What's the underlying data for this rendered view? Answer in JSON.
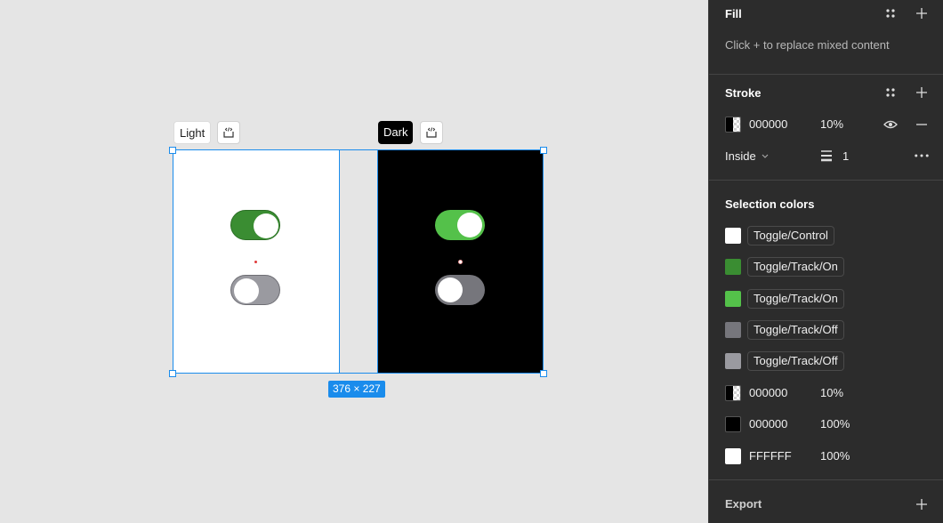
{
  "canvas": {
    "frames": [
      {
        "name": "Light"
      },
      {
        "name": "Dark"
      }
    ],
    "selection_size": "376 × 227"
  },
  "panel": {
    "fill": {
      "title": "Fill",
      "hint": "Click + to replace mixed content"
    },
    "stroke": {
      "title": "Stroke",
      "color": "000000",
      "opacity": "10%",
      "position": "Inside",
      "weight": "1"
    },
    "selection_colors": {
      "title": "Selection colors",
      "styles": [
        {
          "label": "Toggle/Control",
          "color": "#ffffff"
        },
        {
          "label": "Toggle/Track/On",
          "color": "#3a8d32"
        },
        {
          "label": "Toggle/Track/On",
          "color": "#54c14a"
        },
        {
          "label": "Toggle/Track/Off",
          "color": "#76767c"
        },
        {
          "label": "Toggle/Track/Off",
          "color": "#9a9aa0"
        }
      ],
      "raw": [
        {
          "hex": "000000",
          "opacity": "10%"
        },
        {
          "hex": "000000",
          "opacity": "100%"
        },
        {
          "hex": "FFFFFF",
          "opacity": "100%"
        }
      ]
    },
    "export": {
      "title": "Export"
    }
  }
}
